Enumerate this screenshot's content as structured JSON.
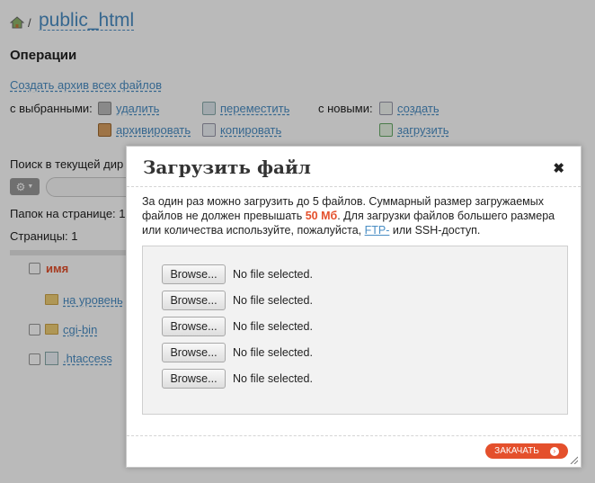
{
  "breadcrumb": {
    "separator": "/",
    "current_dir": "public_html"
  },
  "operations": {
    "title": "Операции",
    "archive_all": "Создать архив всех файлов",
    "with_selected_label": "с выбранными:",
    "with_new_label": "с новыми:",
    "actions": {
      "delete": "удалить",
      "move": "переместить",
      "create": "создать",
      "archive": "архивировать",
      "copy": "копировать",
      "upload": "загрузить"
    }
  },
  "search": {
    "label": "Поиск в текущей дир"
  },
  "listing": {
    "per_page": "Папок на странице: 1",
    "pages": "Страницы: 1",
    "name_header": "имя",
    "items": [
      "на уровень",
      "cgi-bin",
      ".htaccess"
    ]
  },
  "dialog": {
    "title": "Загрузить файл",
    "close": "✖",
    "text_part1": "За один раз можно загрузить до 5 файлов. Суммарный размер загружаемых файлов не должен превышать ",
    "size_limit": "50 Мб",
    "text_part2": ". Для загрузки файлов большего размера или количества используйте, пожалуйста, ",
    "ftp_link": "FTP-",
    "text_part3": " или SSH-доступ.",
    "file_inputs": [
      {
        "button": "Browse...",
        "status": "No file selected."
      },
      {
        "button": "Browse...",
        "status": "No file selected."
      },
      {
        "button": "Browse...",
        "status": "No file selected."
      },
      {
        "button": "Browse...",
        "status": "No file selected."
      },
      {
        "button": "Browse...",
        "status": "No file selected."
      }
    ],
    "submit": "ЗАКАЧАТЬ",
    "submit_arrow": "›"
  },
  "colors": {
    "accent": "#e4502c",
    "link": "#4a8ec4"
  }
}
